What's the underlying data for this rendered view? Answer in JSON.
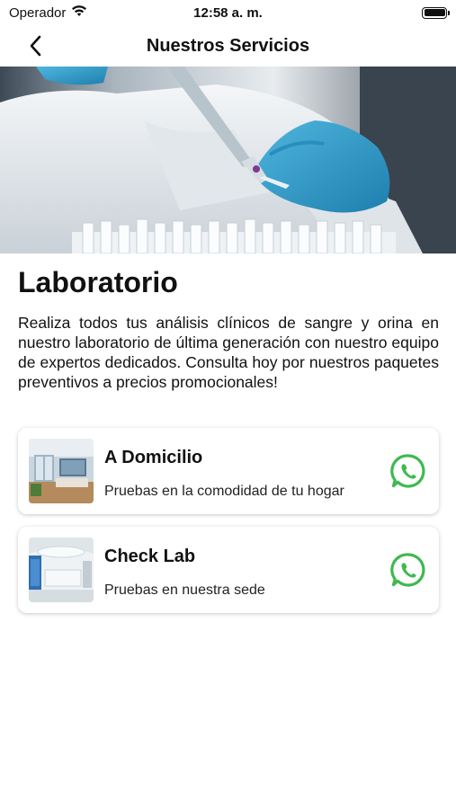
{
  "status_bar": {
    "carrier": "Operador",
    "time": "12:58 a. m."
  },
  "nav": {
    "title": "Nuestros Servicios",
    "back_icon": "chevron-left-icon"
  },
  "hero": {
    "image": "laboratory-pipette-photo"
  },
  "section": {
    "title": "Laboratorio",
    "description": "Realiza todos tus análisis clínicos de sangre y orina en nuestro laboratorio de última generación con nuestro equipo de expertos dedicados. Consulta hoy por nuestros paquetes preventivos a precios promocionales!"
  },
  "services": [
    {
      "title": "A Domicilio",
      "subtitle": "Pruebas en la comodidad de tu hogar",
      "thumbnail": "home-interior-photo",
      "action_icon": "whatsapp-icon"
    },
    {
      "title": "Check Lab",
      "subtitle": "Pruebas en nuestra sede",
      "thumbnail": "clinic-interior-photo",
      "action_icon": "whatsapp-icon"
    }
  ],
  "colors": {
    "whatsapp_green": "#3FB950",
    "text": "#111111",
    "background": "#FFFFFF"
  }
}
